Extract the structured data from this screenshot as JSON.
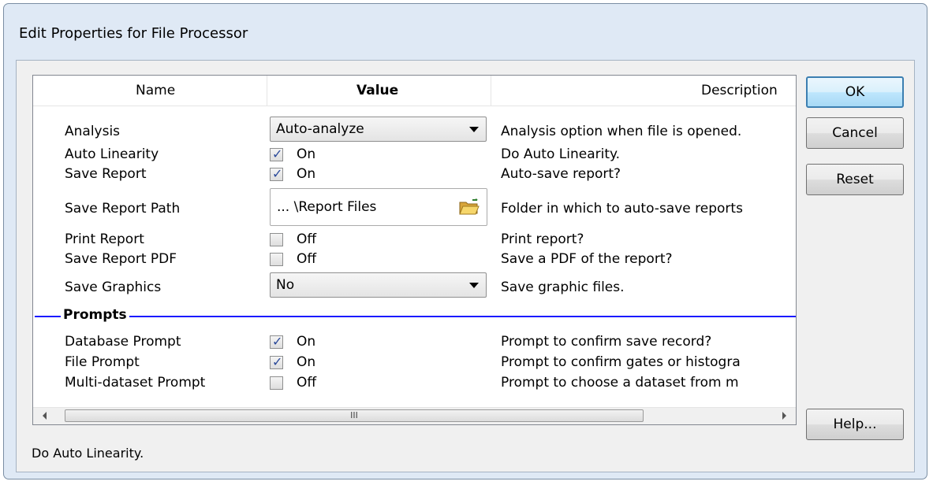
{
  "window": {
    "title": "Edit Properties for File Processor"
  },
  "grid": {
    "headers": {
      "name": "Name",
      "value": "Value",
      "description": "Description"
    },
    "rows": [
      {
        "name": "Analysis",
        "type": "combo",
        "value": "Auto-analyze",
        "description": "Analysis option when file is opened."
      },
      {
        "name": "Auto Linearity",
        "type": "checkbox",
        "checked": true,
        "value": "On",
        "description": "Do Auto Linearity."
      },
      {
        "name": "Save Report",
        "type": "checkbox",
        "checked": true,
        "value": "On",
        "description": "Auto-save report?"
      },
      {
        "name": "Save Report Path",
        "type": "path",
        "value": "... \\Report Files",
        "description": "Folder in which to auto-save reports"
      },
      {
        "name": "Print Report",
        "type": "checkbox",
        "checked": false,
        "value": "Off",
        "description": "Print report?"
      },
      {
        "name": "Save Report PDF",
        "type": "checkbox",
        "checked": false,
        "value": "Off",
        "description": "Save a PDF of the report?"
      },
      {
        "name": "Save Graphics",
        "type": "combo",
        "value": "No",
        "description": "Save graphic files."
      }
    ],
    "section": "Prompts",
    "section_rows": [
      {
        "name": "Database Prompt",
        "type": "checkbox",
        "checked": true,
        "value": "On",
        "description": "Prompt to confirm save record?"
      },
      {
        "name": "File Prompt",
        "type": "checkbox",
        "checked": true,
        "value": "On",
        "description": "Prompt to confirm gates or histogra"
      },
      {
        "name": "Multi-dataset Prompt",
        "type": "checkbox",
        "checked": false,
        "value": "Off",
        "description": "Prompt to choose a dataset from m"
      }
    ],
    "scroll_grip": "III"
  },
  "buttons": {
    "ok": "OK",
    "cancel": "Cancel",
    "reset": "Reset",
    "help": "Help..."
  },
  "status_text": "Do Auto Linearity.",
  "colors": {
    "accent": "#3c7fb1",
    "section_line": "#1a1aff",
    "frame": "#dfe9f5"
  },
  "icons": {
    "folder": "folder-open-icon",
    "dropdown": "chevron-down-icon"
  }
}
